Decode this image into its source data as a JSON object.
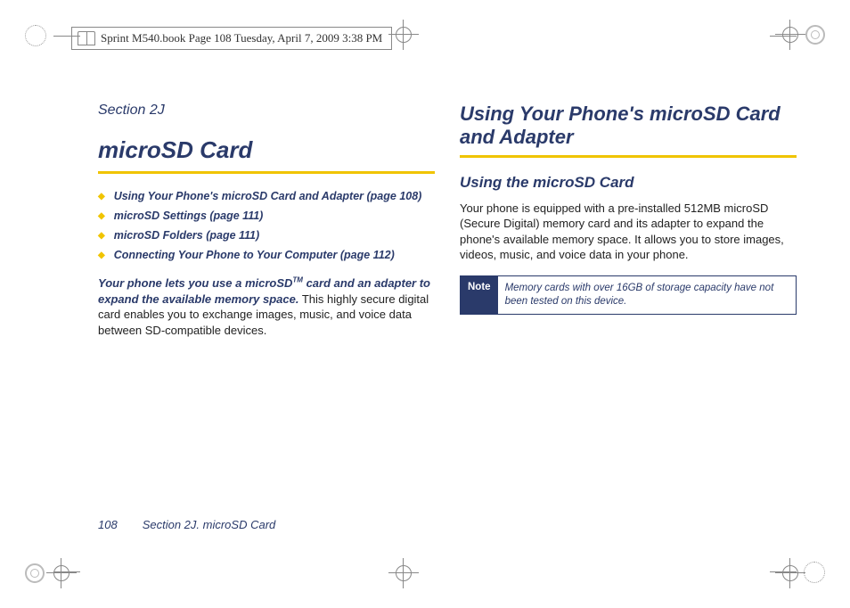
{
  "header": {
    "text": "Sprint M540.book  Page 108  Tuesday, April 7, 2009  3:38 PM"
  },
  "left": {
    "section_label": "Section 2J",
    "title": "microSD Card",
    "toc": [
      "Using Your Phone's microSD Card and Adapter (page 108)",
      "microSD Settings (page 111)",
      "microSD Folders (page 111)",
      "Connecting Your Phone to Your Computer (page 112)"
    ],
    "intro_lead": "Your phone lets you use a microSD",
    "intro_tm": "TM",
    "intro_lead_tail": " card and an adapter to expand the available memory space.",
    "intro_rest": " This highly secure digital card enables you to exchange images, music, and voice data between SD-compatible devices."
  },
  "right": {
    "h2": "Using Your Phone's microSD Card and Adapter",
    "h3": "Using the microSD Card",
    "body": "Your phone is equipped with a pre-installed 512MB microSD (Secure Digital) memory card and its adapter to expand the phone's available memory space. It allows you to store images, videos, music, and voice data in your phone.",
    "note_label": "Note",
    "note_body": "Memory cards with over 16GB of storage capacity have not been tested on this device."
  },
  "footer": {
    "page_number": "108",
    "running": "Section 2J. microSD Card"
  }
}
